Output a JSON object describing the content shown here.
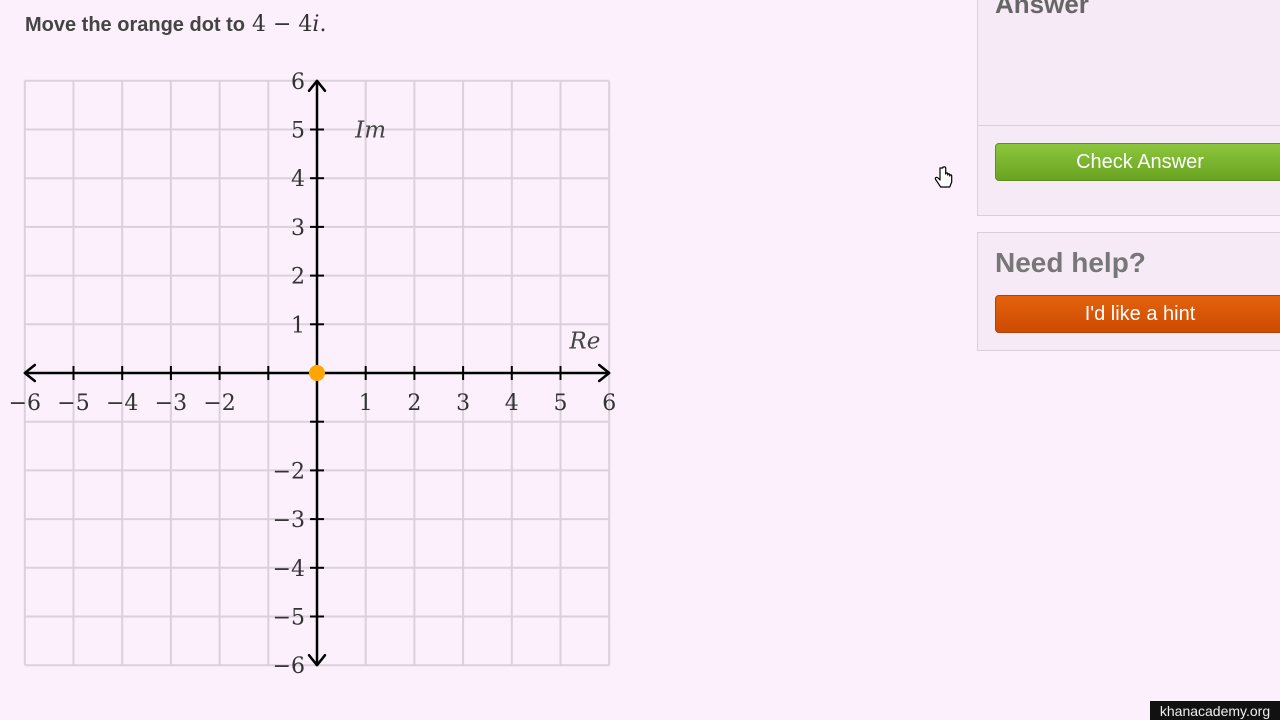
{
  "prompt": {
    "text": "Move the orange dot to",
    "math_expr": "4 − 4",
    "math_var": "i",
    "math_end": "."
  },
  "graph": {
    "x_range": [
      -6,
      6
    ],
    "y_range": [
      -6,
      6
    ],
    "x_tick_labels": [
      "−6",
      "−5",
      "−4",
      "−3",
      "−2",
      "1",
      "2",
      "3",
      "4",
      "5",
      "6"
    ],
    "x_tick_values": [
      -6,
      -5,
      -4,
      -3,
      -2,
      1,
      2,
      3,
      4,
      5,
      6
    ],
    "y_tick_labels": [
      "6",
      "5",
      "4",
      "3",
      "2",
      "1",
      "−2",
      "−3",
      "−4",
      "−5",
      "−6"
    ],
    "y_tick_values": [
      6,
      5,
      4,
      3,
      2,
      1,
      -2,
      -3,
      -4,
      -5,
      -6
    ],
    "real_axis_label": "Re",
    "imag_axis_label": "Im",
    "dot": {
      "re": 0,
      "im": 0,
      "color": "#ffa500"
    },
    "grid_color": "#dcd0dc",
    "axis_color": "#000000"
  },
  "answer_panel": {
    "title": "Answer",
    "check_button_label": "Check Answer",
    "check_button_color": "#7ab52f"
  },
  "help_panel": {
    "title": "Need help?",
    "hint_button_label": "I'd like a hint",
    "hint_button_color": "#d9540a"
  },
  "watermark": "khanacademy.org",
  "cursor_icon": "hand-pointer-icon"
}
